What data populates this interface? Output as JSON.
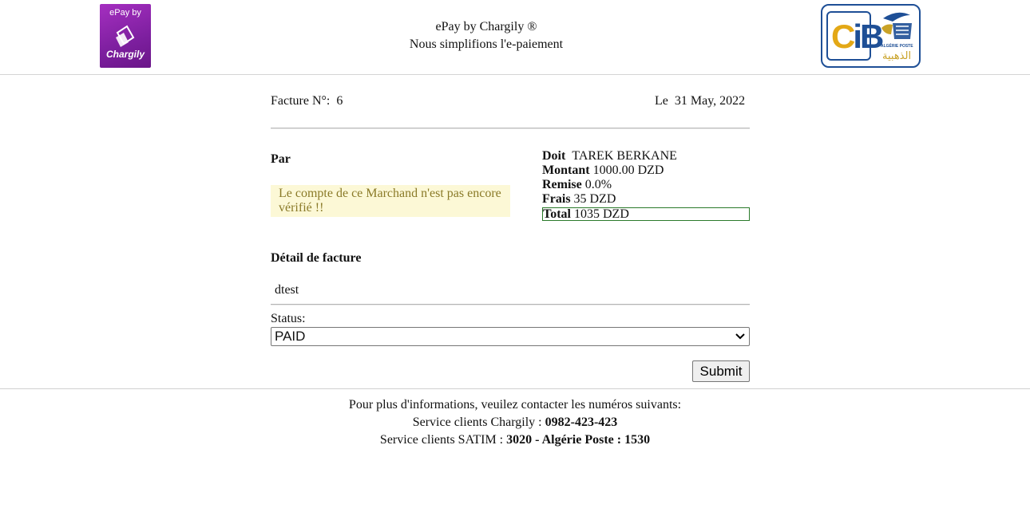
{
  "header": {
    "left_logo": {
      "line1": "ePay by",
      "line2": "Chargily"
    },
    "title": "ePay by Chargily ®",
    "subtitle": "Nous simplifions l'e-paiement",
    "right_logo": {
      "cib": "CIB",
      "poste_small": "ALGÉRIE POSTE",
      "poste_ar": "الذهبية"
    }
  },
  "invoice": {
    "number_label": "Facture N°:",
    "number": "6",
    "date_label": "Le",
    "date": "31 May, 2022"
  },
  "par": {
    "title": "Par",
    "warning": "Le compte de ce Marchand n'est pas encore vérifié !!"
  },
  "amounts": {
    "doit_label": "Doit",
    "doit": "TAREK BERKANE",
    "montant_label": "Montant",
    "montant": "1000.00 DZD",
    "remise_label": "Remise",
    "remise": "0.0%",
    "frais_label": "Frais",
    "frais": "35 DZD",
    "total_label": "Total",
    "total": "1035 DZD"
  },
  "detail": {
    "title": "Détail de facture",
    "value": "dtest"
  },
  "status": {
    "label": "Status:",
    "selected": "PAID"
  },
  "submit_label": "Submit",
  "footer": {
    "line1": "Pour plus d'informations, veuilez contacter les numéros suivants:",
    "chargily_label": "Service clients Chargily :",
    "chargily_phone": "0982-423-423",
    "satim_label": "Service clients SATIM :",
    "satim_numbers": "3020 - Algérie Poste : 1530"
  },
  "colors": {
    "chargily_purple": "#8e27ad",
    "cib_blue": "#1e4f96",
    "cib_gold": "#e3a816",
    "warning_bg": "#fcf8d6",
    "warning_text": "#8a7a28",
    "total_border": "#2a7a2a"
  },
  "icons": {
    "left_logo": "chargily-logo-icon",
    "right_logo": "cib-algerie-poste-logo-icon",
    "select_chevron": "chevron-down-icon"
  }
}
